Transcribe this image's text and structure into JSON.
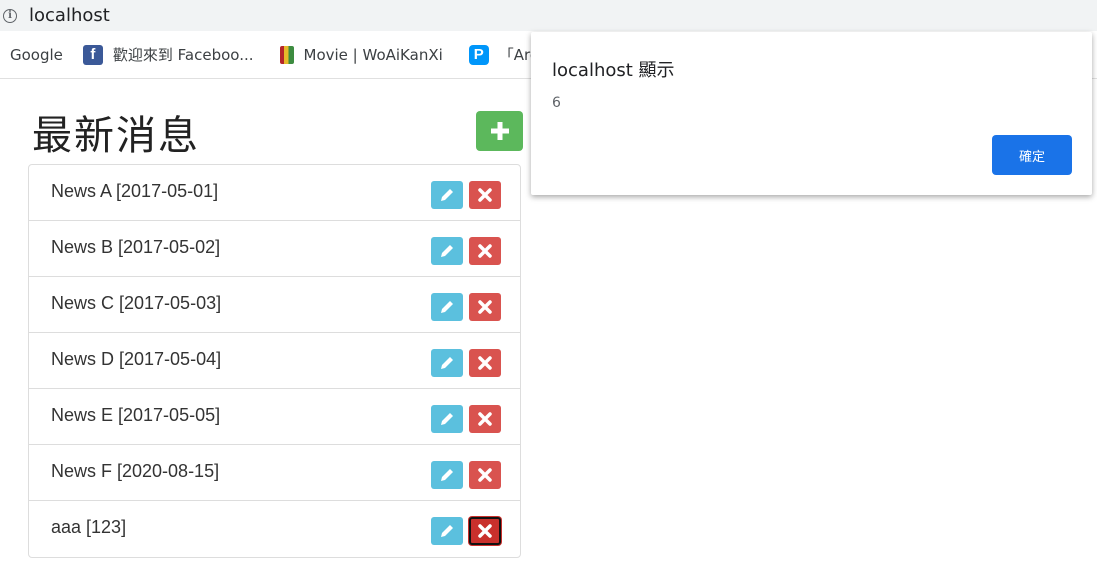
{
  "browser": {
    "url": "localhost",
    "bookmarks": [
      {
        "label": "Google",
        "icon": "google-favicon"
      },
      {
        "label": "歡迎來到 Faceboo...",
        "icon": "facebook-icon",
        "color": "#3b5998"
      },
      {
        "label": "Movie | WoAiKanXi",
        "icon": "movie-icon"
      },
      {
        "label": "「Aren",
        "icon": "pixiv-icon",
        "color": "#0096fa"
      }
    ]
  },
  "page": {
    "title": "最新消息",
    "add_button_icon": "plus-icon"
  },
  "news": [
    {
      "label": "News A [2017-05-01]"
    },
    {
      "label": "News B [2017-05-02]"
    },
    {
      "label": "News C [2017-05-03]"
    },
    {
      "label": "News D [2017-05-04]"
    },
    {
      "label": "News E [2017-05-05]"
    },
    {
      "label": "News F [2020-08-15]"
    },
    {
      "label": "aaa [123]",
      "focused_delete": true
    }
  ],
  "colors": {
    "add": "#5cb85c",
    "edit": "#5bc0de",
    "delete": "#d9534f",
    "dialog_ok": "#1a73e8"
  },
  "dialog": {
    "title": "localhost 顯示",
    "message": "6",
    "ok_label": "確定"
  }
}
